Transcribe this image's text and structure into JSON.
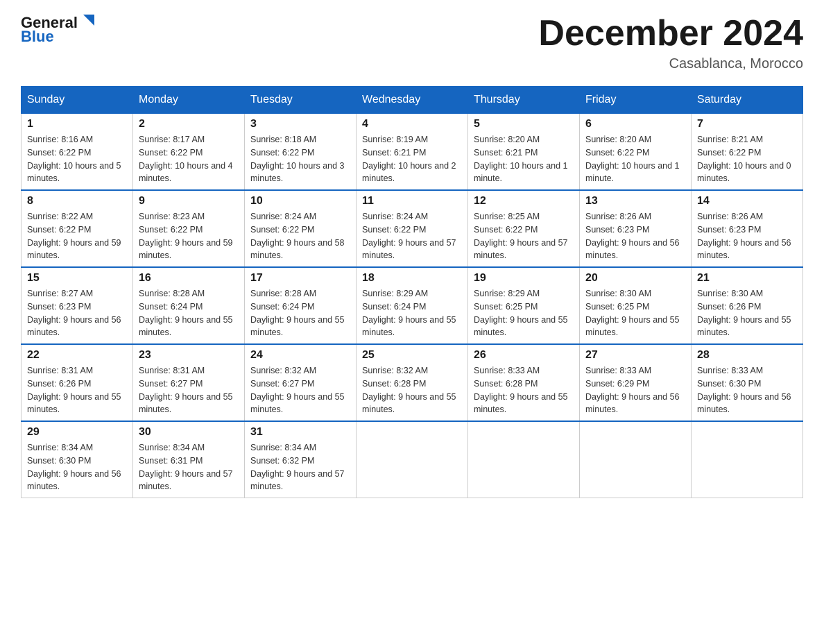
{
  "header": {
    "logo_general": "General",
    "logo_blue": "Blue",
    "month_title": "December 2024",
    "location": "Casablanca, Morocco"
  },
  "weekdays": [
    "Sunday",
    "Monday",
    "Tuesday",
    "Wednesday",
    "Thursday",
    "Friday",
    "Saturday"
  ],
  "weeks": [
    [
      {
        "day": "1",
        "sunrise": "8:16 AM",
        "sunset": "6:22 PM",
        "daylight": "10 hours and 5 minutes."
      },
      {
        "day": "2",
        "sunrise": "8:17 AM",
        "sunset": "6:22 PM",
        "daylight": "10 hours and 4 minutes."
      },
      {
        "day": "3",
        "sunrise": "8:18 AM",
        "sunset": "6:22 PM",
        "daylight": "10 hours and 3 minutes."
      },
      {
        "day": "4",
        "sunrise": "8:19 AM",
        "sunset": "6:21 PM",
        "daylight": "10 hours and 2 minutes."
      },
      {
        "day": "5",
        "sunrise": "8:20 AM",
        "sunset": "6:21 PM",
        "daylight": "10 hours and 1 minute."
      },
      {
        "day": "6",
        "sunrise": "8:20 AM",
        "sunset": "6:22 PM",
        "daylight": "10 hours and 1 minute."
      },
      {
        "day": "7",
        "sunrise": "8:21 AM",
        "sunset": "6:22 PM",
        "daylight": "10 hours and 0 minutes."
      }
    ],
    [
      {
        "day": "8",
        "sunrise": "8:22 AM",
        "sunset": "6:22 PM",
        "daylight": "9 hours and 59 minutes."
      },
      {
        "day": "9",
        "sunrise": "8:23 AM",
        "sunset": "6:22 PM",
        "daylight": "9 hours and 59 minutes."
      },
      {
        "day": "10",
        "sunrise": "8:24 AM",
        "sunset": "6:22 PM",
        "daylight": "9 hours and 58 minutes."
      },
      {
        "day": "11",
        "sunrise": "8:24 AM",
        "sunset": "6:22 PM",
        "daylight": "9 hours and 57 minutes."
      },
      {
        "day": "12",
        "sunrise": "8:25 AM",
        "sunset": "6:22 PM",
        "daylight": "9 hours and 57 minutes."
      },
      {
        "day": "13",
        "sunrise": "8:26 AM",
        "sunset": "6:23 PM",
        "daylight": "9 hours and 56 minutes."
      },
      {
        "day": "14",
        "sunrise": "8:26 AM",
        "sunset": "6:23 PM",
        "daylight": "9 hours and 56 minutes."
      }
    ],
    [
      {
        "day": "15",
        "sunrise": "8:27 AM",
        "sunset": "6:23 PM",
        "daylight": "9 hours and 56 minutes."
      },
      {
        "day": "16",
        "sunrise": "8:28 AM",
        "sunset": "6:24 PM",
        "daylight": "9 hours and 55 minutes."
      },
      {
        "day": "17",
        "sunrise": "8:28 AM",
        "sunset": "6:24 PM",
        "daylight": "9 hours and 55 minutes."
      },
      {
        "day": "18",
        "sunrise": "8:29 AM",
        "sunset": "6:24 PM",
        "daylight": "9 hours and 55 minutes."
      },
      {
        "day": "19",
        "sunrise": "8:29 AM",
        "sunset": "6:25 PM",
        "daylight": "9 hours and 55 minutes."
      },
      {
        "day": "20",
        "sunrise": "8:30 AM",
        "sunset": "6:25 PM",
        "daylight": "9 hours and 55 minutes."
      },
      {
        "day": "21",
        "sunrise": "8:30 AM",
        "sunset": "6:26 PM",
        "daylight": "9 hours and 55 minutes."
      }
    ],
    [
      {
        "day": "22",
        "sunrise": "8:31 AM",
        "sunset": "6:26 PM",
        "daylight": "9 hours and 55 minutes."
      },
      {
        "day": "23",
        "sunrise": "8:31 AM",
        "sunset": "6:27 PM",
        "daylight": "9 hours and 55 minutes."
      },
      {
        "day": "24",
        "sunrise": "8:32 AM",
        "sunset": "6:27 PM",
        "daylight": "9 hours and 55 minutes."
      },
      {
        "day": "25",
        "sunrise": "8:32 AM",
        "sunset": "6:28 PM",
        "daylight": "9 hours and 55 minutes."
      },
      {
        "day": "26",
        "sunrise": "8:33 AM",
        "sunset": "6:28 PM",
        "daylight": "9 hours and 55 minutes."
      },
      {
        "day": "27",
        "sunrise": "8:33 AM",
        "sunset": "6:29 PM",
        "daylight": "9 hours and 56 minutes."
      },
      {
        "day": "28",
        "sunrise": "8:33 AM",
        "sunset": "6:30 PM",
        "daylight": "9 hours and 56 minutes."
      }
    ],
    [
      {
        "day": "29",
        "sunrise": "8:34 AM",
        "sunset": "6:30 PM",
        "daylight": "9 hours and 56 minutes."
      },
      {
        "day": "30",
        "sunrise": "8:34 AM",
        "sunset": "6:31 PM",
        "daylight": "9 hours and 57 minutes."
      },
      {
        "day": "31",
        "sunrise": "8:34 AM",
        "sunset": "6:32 PM",
        "daylight": "9 hours and 57 minutes."
      },
      null,
      null,
      null,
      null
    ]
  ],
  "labels": {
    "sunrise": "Sunrise:",
    "sunset": "Sunset:",
    "daylight": "Daylight:"
  }
}
